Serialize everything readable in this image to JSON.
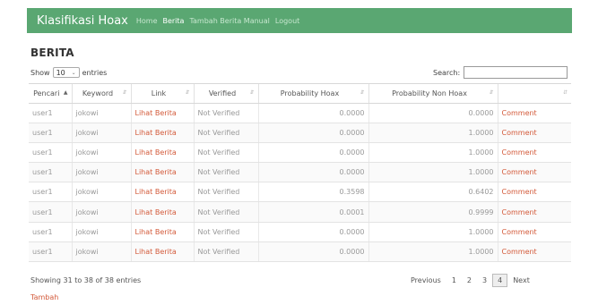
{
  "navbar": {
    "brand": "Klasifikasi Hoax",
    "links": [
      "Home",
      "Berita",
      "Tambah Berita Manual",
      "Logout"
    ]
  },
  "page": {
    "title": "BERITA"
  },
  "length": {
    "prefix": "Show",
    "value": "10",
    "suffix": "entries"
  },
  "search": {
    "label": "Search:",
    "value": ""
  },
  "table": {
    "headers": [
      "Pencari",
      "Keyword",
      "Link",
      "Verified",
      "Probability Hoax",
      "Probability Non Hoax",
      ""
    ],
    "rows": [
      [
        "user1",
        "jokowi",
        "Lihat Berita",
        "Not Verified",
        "0.0000",
        "0.0000",
        "Comment"
      ],
      [
        "user1",
        "jokowi",
        "Lihat Berita",
        "Not Verified",
        "0.0000",
        "1.0000",
        "Comment"
      ],
      [
        "user1",
        "jokowi",
        "Lihat Berita",
        "Not Verified",
        "0.0000",
        "1.0000",
        "Comment"
      ],
      [
        "user1",
        "jokowi",
        "Lihat Berita",
        "Not Verified",
        "0.0000",
        "1.0000",
        "Comment"
      ],
      [
        "user1",
        "jokowi",
        "Lihat Berita",
        "Not Verified",
        "0.3598",
        "0.6402",
        "Comment"
      ],
      [
        "user1",
        "jokowi",
        "Lihat Berita",
        "Not Verified",
        "0.0001",
        "0.9999",
        "Comment"
      ],
      [
        "user1",
        "jokowi",
        "Lihat Berita",
        "Not Verified",
        "0.0000",
        "1.0000",
        "Comment"
      ],
      [
        "user1",
        "jokowi",
        "Lihat Berita",
        "Not Verified",
        "0.0000",
        "1.0000",
        "Comment"
      ]
    ]
  },
  "footer": {
    "info": "Showing 31 to 38 of 38 entries",
    "pagination": {
      "previous": "Previous",
      "pages": [
        "1",
        "2",
        "3",
        "4"
      ],
      "current": "4",
      "next": "Next"
    },
    "add_link": "Tambah"
  },
  "colors": {
    "navbar": "#5aa772",
    "link": "#d35a3a"
  }
}
